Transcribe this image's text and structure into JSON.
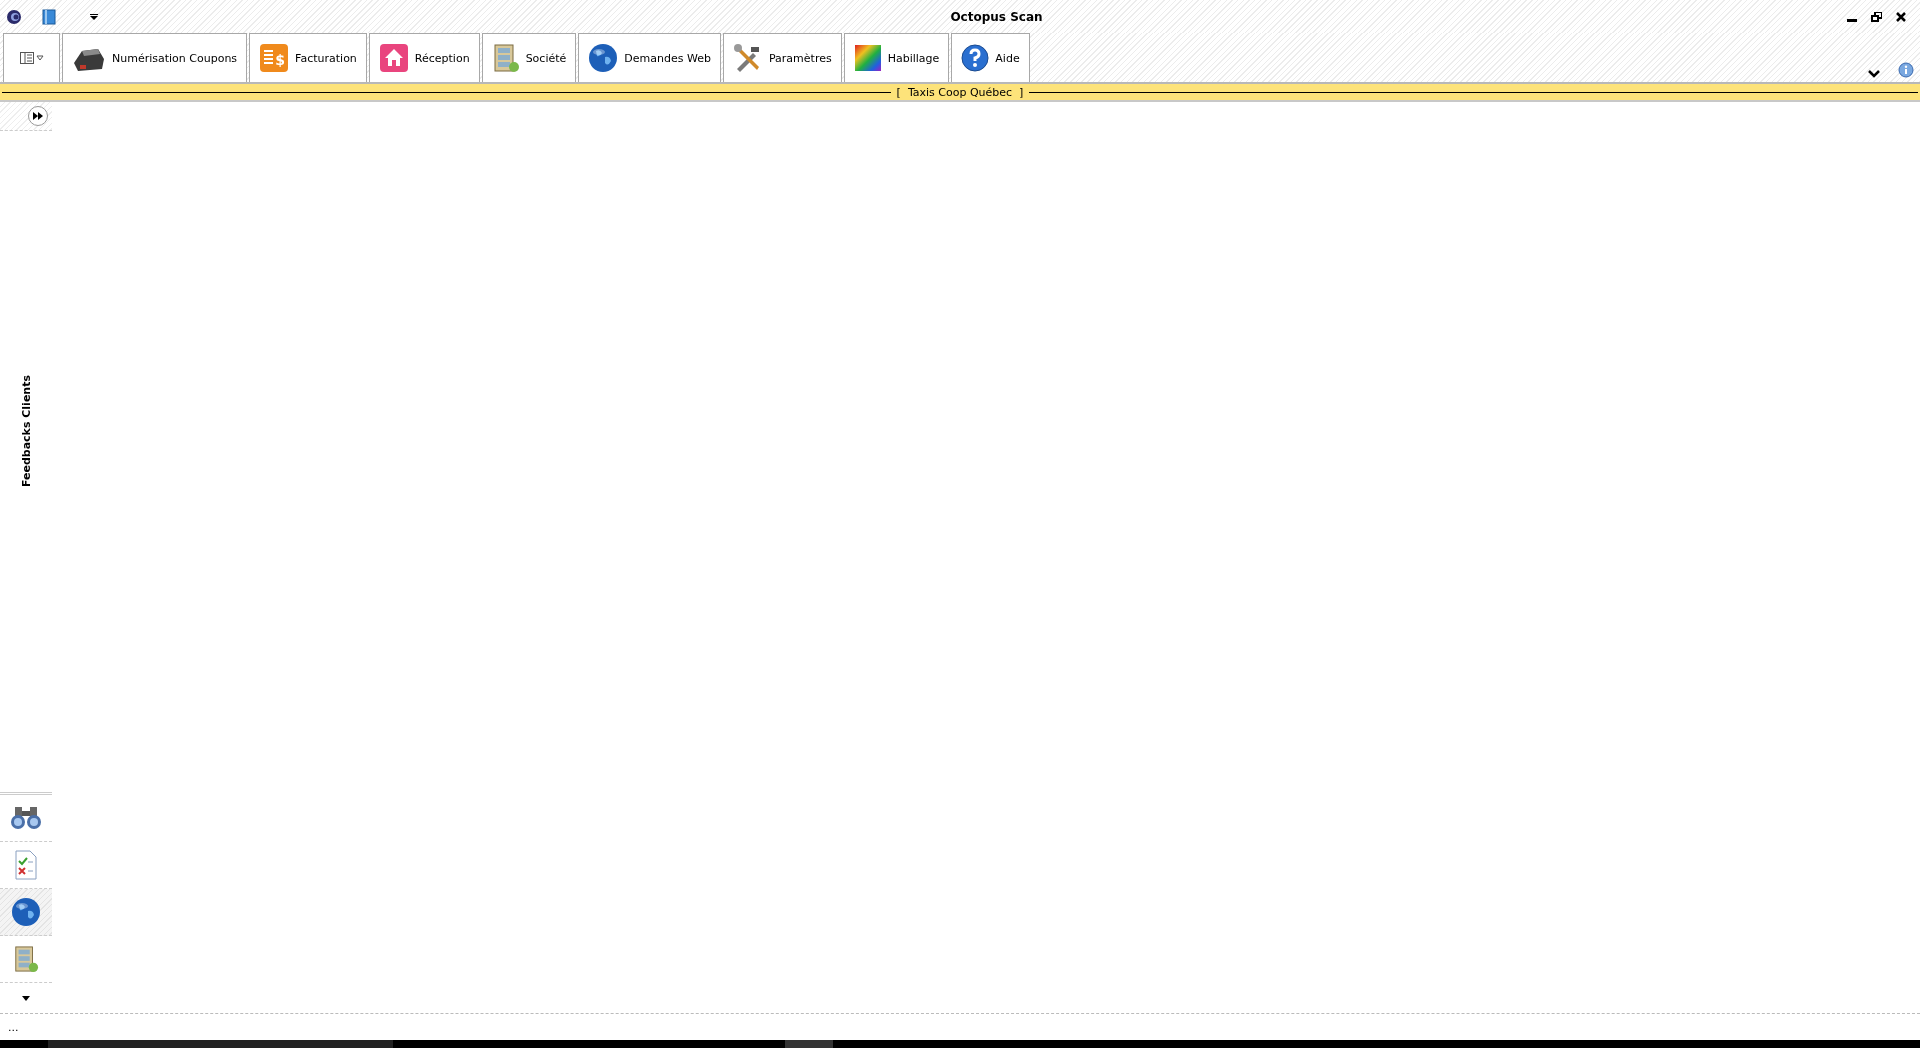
{
  "window": {
    "title": "Octopus Scan"
  },
  "ribbon": {
    "tabs": [
      {
        "label": "Numérisation Coupons",
        "kind": "scanner"
      },
      {
        "label": "Facturation",
        "kind": "invoice",
        "icon_glyph": "$"
      },
      {
        "label": "Réception",
        "kind": "home"
      },
      {
        "label": "Société",
        "kind": "cabinet"
      },
      {
        "label": "Demandes Web",
        "kind": "globe"
      },
      {
        "label": "Paramètres",
        "kind": "tools"
      },
      {
        "label": "Habillage",
        "kind": "palette"
      },
      {
        "label": "Aide",
        "kind": "help"
      }
    ]
  },
  "banner": {
    "text": "[  Taxis Coop Québec  ]"
  },
  "side_panel": {
    "title": "Feedbacks Clients",
    "shortcuts": [
      {
        "kind": "binoculars",
        "selected": false
      },
      {
        "kind": "checklist",
        "selected": false
      },
      {
        "kind": "globe",
        "selected": true
      },
      {
        "kind": "cabinet",
        "selected": false
      }
    ]
  },
  "status_bar": {
    "text": "..."
  }
}
